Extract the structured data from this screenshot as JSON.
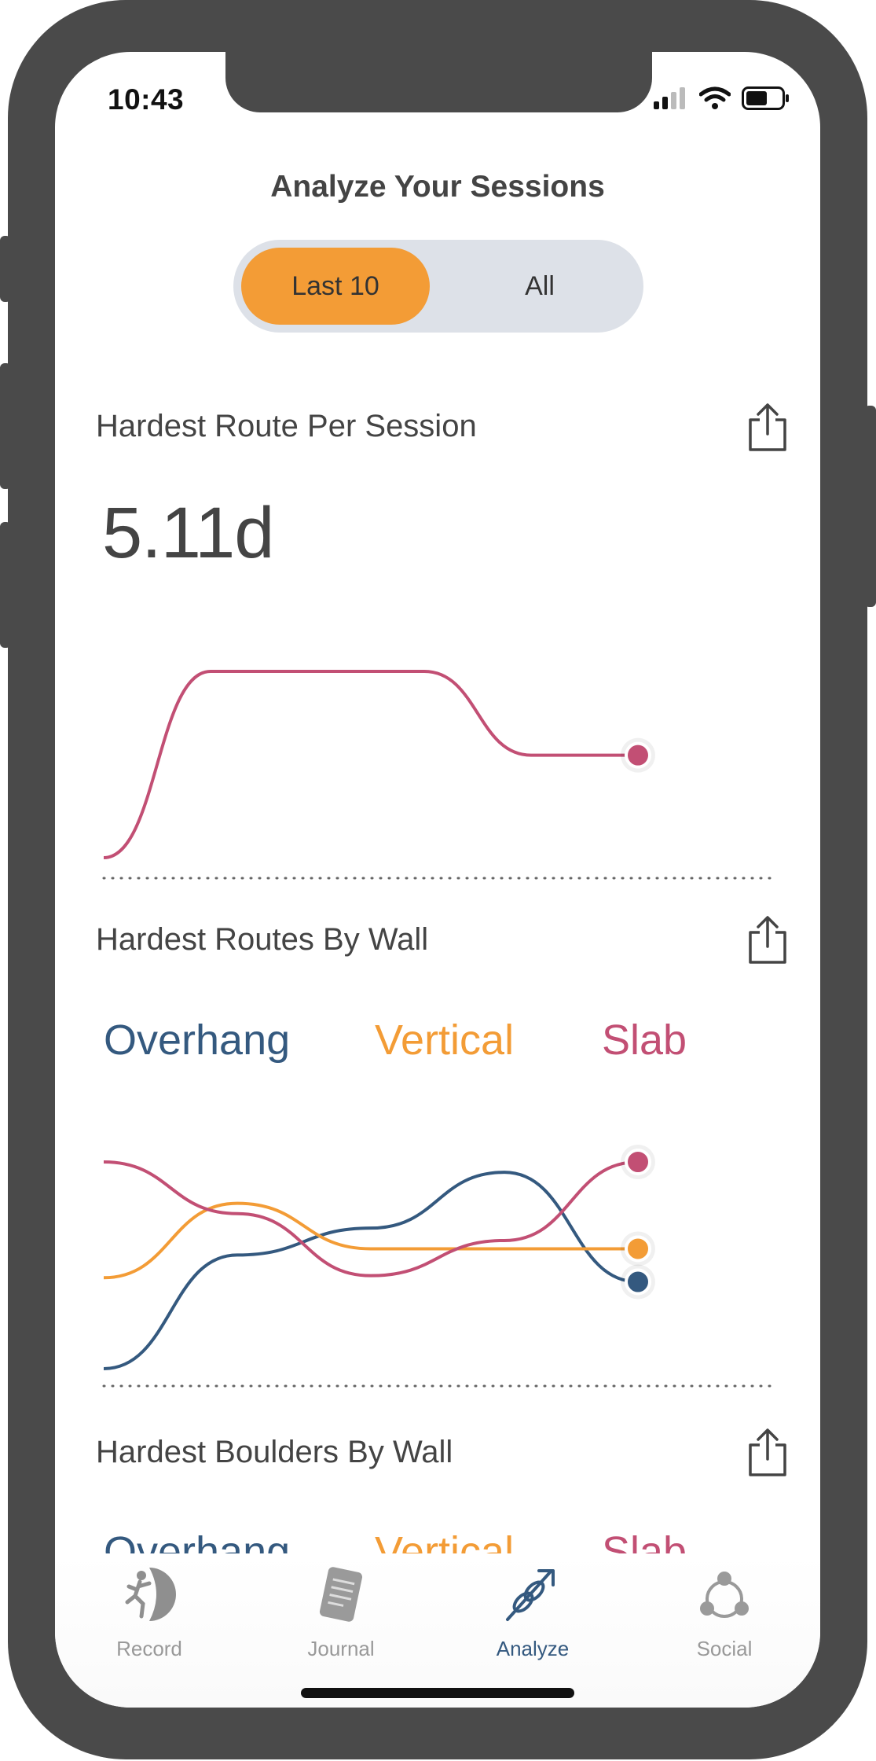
{
  "status_bar": {
    "time": "10:43"
  },
  "header": {
    "title": "Analyze Your Sessions"
  },
  "segment": {
    "options": [
      "Last 10",
      "All"
    ],
    "selected": "Last 10"
  },
  "section1": {
    "title": "Hardest Route Per Session",
    "value": "5.11d"
  },
  "section2": {
    "title": "Hardest Routes By Wall",
    "legend": [
      {
        "name": "Overhang",
        "color": "#34597f"
      },
      {
        "name": "Vertical",
        "color": "#f39c36"
      },
      {
        "name": "Slab",
        "color": "#c24f74"
      }
    ]
  },
  "section3": {
    "title": "Hardest Boulders By Wall",
    "legend": [
      {
        "name": "Overhang",
        "color": "#34597f"
      },
      {
        "name": "Vertical",
        "color": "#f39c36"
      },
      {
        "name": "Slab",
        "color": "#c24f74"
      }
    ]
  },
  "chart_data": [
    {
      "type": "line",
      "title": "Hardest Route Per Session",
      "series": [
        {
          "values": [
            0,
            1,
            1,
            1,
            0.55,
            0.55
          ],
          "color": "#c24f74"
        }
      ]
    },
    {
      "type": "line",
      "title": "Hardest Routes By Wall",
      "series": [
        {
          "name": "Overhang",
          "values": [
            0,
            0.55,
            0.68,
            0.95,
            0.42
          ],
          "color": "#34597f"
        },
        {
          "name": "Vertical",
          "values": [
            0.44,
            0.8,
            0.58,
            0.58,
            0.58
          ],
          "color": "#f39c36"
        },
        {
          "name": "Slab",
          "values": [
            1,
            0.75,
            0.45,
            0.62,
            1
          ],
          "color": "#c24f74"
        }
      ]
    }
  ],
  "tabbar": {
    "items": [
      {
        "label": "Record",
        "icon": "climber-icon",
        "active": false
      },
      {
        "label": "Journal",
        "icon": "journal-icon",
        "active": false
      },
      {
        "label": "Analyze",
        "icon": "knot-arrow-icon",
        "active": true
      },
      {
        "label": "Social",
        "icon": "social-icon",
        "active": false
      }
    ]
  },
  "colors": {
    "accent": "#f39c36",
    "active_tab": "#34597f",
    "slab": "#c24f74"
  }
}
